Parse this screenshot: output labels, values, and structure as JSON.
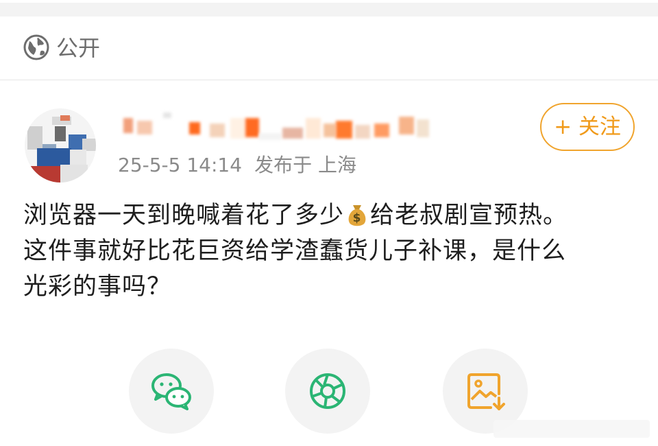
{
  "visibility": {
    "icon": "globe-icon",
    "label": "公开"
  },
  "author": {
    "name": "",
    "avatar": "avatar-image"
  },
  "post_meta": {
    "time": "25-5-5 14:14",
    "posted_label": "发布于 上海"
  },
  "follow_button": {
    "label": "+ 关注"
  },
  "post": {
    "line1_before_emoji": "浏览器一天到晚喊着花了多少",
    "emoji": "money-bag-emoji",
    "line1_after_emoji": "给老叔剧宣预热。",
    "line2": "这件事就好比花巨资给学渣蠢货儿子补课，是什么",
    "line3": "光彩的事吗？"
  },
  "share": [
    {
      "icon": "wechat-icon",
      "color": "#2bb574"
    },
    {
      "icon": "moments-icon",
      "color": "#2bb574"
    },
    {
      "icon": "save-image-icon",
      "color": "#f0a42d"
    }
  ],
  "colors": {
    "accent": "#f0a42d",
    "meta_gray": "#8a8a8a",
    "share_green": "#2bb574"
  }
}
